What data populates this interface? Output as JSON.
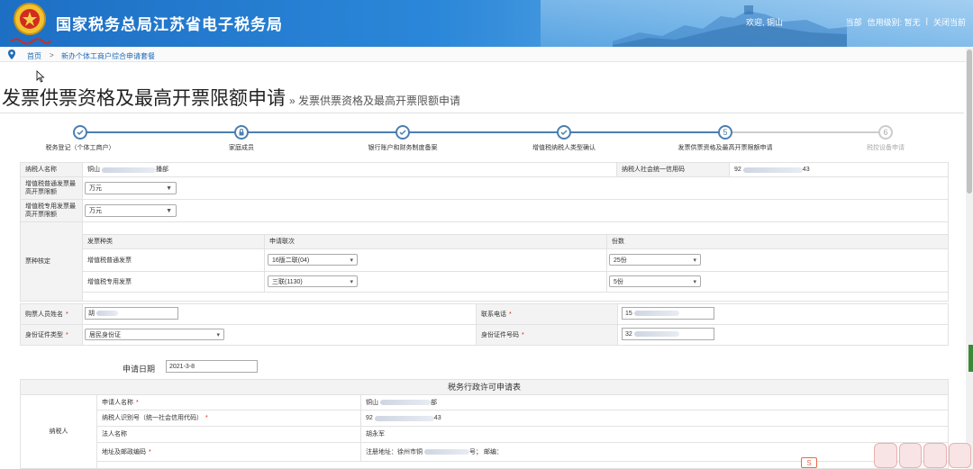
{
  "header": {
    "site_title": "国家税务总局江苏省电子税务局",
    "welcome": "欢迎, 铜山",
    "level_label": "信用级别: 暂无",
    "close_label": "关闭当前",
    "partial_left": "当部"
  },
  "breadcrumb": {
    "home": "首页",
    "sep": ">",
    "current": "新办个体工商户综合申请套餐"
  },
  "page": {
    "title": "发票供票资格及最高开票限额申请",
    "subtitle": "» 发票供票资格及最高开票限额申请"
  },
  "steps": [
    {
      "label": "税务登记（个体工商户）",
      "state": "done"
    },
    {
      "label": "家庭成员",
      "state": "locked"
    },
    {
      "label": "银行账户和财务制度备案",
      "state": "done"
    },
    {
      "label": "增值税纳税人类型确认",
      "state": "done"
    },
    {
      "label": "发票供票资格及最高开票限额申请",
      "state": "current",
      "num": "5"
    },
    {
      "label": "税控设备申请",
      "state": "todo",
      "num": "6"
    }
  ],
  "taxpayer": {
    "name_label": "纳税人名称",
    "name_value": "铜山",
    "name_tail": "播部",
    "credit_label": "纳税人社会统一信用码",
    "credit_value_head": "92",
    "credit_value_tail": "43",
    "general_limit_label": "增值税普通发票最高开票限额",
    "general_limit_value": "万元",
    "special_limit_label": "增值税专用发票最高开票限额",
    "special_limit_value": "万元"
  },
  "invoice_check": {
    "label": "票种核定",
    "headers": [
      "发票种类",
      "申请联次",
      "份数"
    ],
    "rows": [
      {
        "type": "增值税普通发票",
        "copies": "16版二联(04)",
        "count": "25份"
      },
      {
        "type": "增值税专用发票",
        "copies": "三联(1130)",
        "count": "5份"
      }
    ]
  },
  "buyer": {
    "name_label": "购票人员姓名",
    "name_value": "胡",
    "phone_label": "联系电话",
    "phone_value": "15",
    "id_type_label": "身份证件类型",
    "id_type_value": "居民身份证",
    "id_no_label": "身份证件号码",
    "id_no_value": "32"
  },
  "apply_date": {
    "label": "申请日期",
    "value": "2021-3-8"
  },
  "permit_form": {
    "title": "税务行政许可申请表",
    "section_label": "纳税人",
    "rows": [
      {
        "label": "申请人名称",
        "value": "铜山",
        "tail": "部"
      },
      {
        "label": "纳税人识别号（统一社会信用代码）",
        "value": "92",
        "tail": "43"
      },
      {
        "label": "法人名称",
        "value": "胡永军"
      },
      {
        "label": "地址及邮政编码",
        "value": "注册地址：徐州市铜",
        "tail": "号； 邮编："
      }
    ]
  },
  "float_icon": "S"
}
